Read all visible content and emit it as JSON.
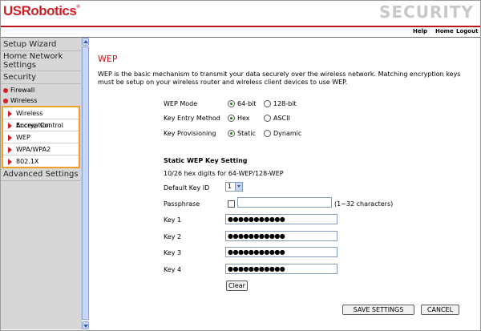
{
  "brand": {
    "logo": "USRobotics",
    "registered": "®",
    "section_title": "SECURITY"
  },
  "topnav": {
    "help": "Help",
    "home": "Home",
    "logout": "Logout"
  },
  "sidebar": {
    "setup_wizard": "Setup Wizard",
    "home_network": "Home Network Settings",
    "security": "Security",
    "firewall": "Firewall",
    "wireless": "Wireless",
    "wireless_items": [
      "Wireless Encryption",
      "Access Control",
      "WEP",
      "WPA/WPA2",
      "802.1X"
    ],
    "advanced": "Advanced Settings"
  },
  "main": {
    "title": "WEP",
    "intro": "WEP is the basic mechanism to transmit your data securely over the wireless network. Matching encryption keys must be setup on your wireless router and wireless client devices to use WEP.",
    "wep_mode": {
      "label": "WEP Mode",
      "opt1": "64-bit",
      "opt2": "128-bit"
    },
    "key_entry": {
      "label": "Key Entry Method",
      "opt1": "Hex",
      "opt2": "ASCII"
    },
    "key_prov": {
      "label": "Key Provisioning",
      "opt1": "Static",
      "opt2": "Dynamic"
    },
    "static_heading": "Static WEP Key Setting",
    "hex_note": "10/26 hex digits for 64-WEP/128-WEP",
    "default_key": {
      "label": "Default Key ID",
      "value": "1"
    },
    "passphrase": {
      "label": "Passphrase",
      "value": "",
      "hint": "(1~32 characters)"
    },
    "keys": [
      {
        "label": "Key 1",
        "value": "●●●●●●●●●●●"
      },
      {
        "label": "Key 2",
        "value": "●●●●●●●●●●●"
      },
      {
        "label": "Key 3",
        "value": "●●●●●●●●●●●"
      },
      {
        "label": "Key 4",
        "value": "●●●●●●●●●●●"
      }
    ],
    "clear": "Clear",
    "save": "SAVE SETTINGS",
    "cancel": "CANCEL"
  },
  "colors": {
    "accent": "#d01f27",
    "sidebar_bg": "#d7d7d7",
    "highlight_border": "#f0a02a"
  },
  "icons": {
    "bullet": "red-dot-icon",
    "arrow": "red-triangle-icon"
  }
}
